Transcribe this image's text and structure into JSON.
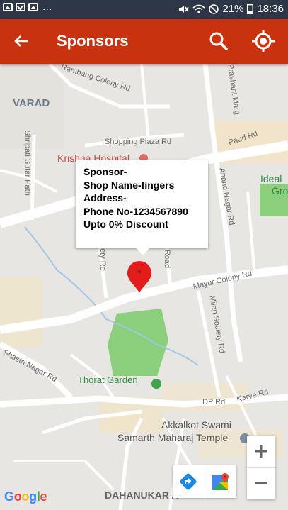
{
  "status_bar": {
    "overflow": "...",
    "battery_pct": "21%",
    "time": "18:36"
  },
  "app_bar": {
    "title": "Sponsors",
    "back_icon": "arrow-left-icon",
    "search_icon": "search-icon",
    "locate_icon": "my-location-icon",
    "color": "#c8320f"
  },
  "map": {
    "labels": {
      "varad": "VARAD",
      "rambaug": "Rambaug Colony Rd",
      "prashant": "Prashant Marg",
      "shopping_plaza": "Shopping Plaza Rd",
      "paud": "Paud Rd",
      "krishna": "Krishna Hospital",
      "shripati": "Shripati Sutar Path",
      "ideal": "Ideal",
      "gro": "Gro",
      "anand": "Anand Nagar Rd",
      "society": "ociety Rd",
      "road": "Road",
      "mayur": "Mayur Colony Rd",
      "milan": "Milan Society Rd",
      "shastri": "Shastri Nagar Rd",
      "thorat": "Thorat Garden",
      "dp": "DP Rd",
      "karve": "Karve Rd",
      "akkalkot_1": "Akkalkot Swami",
      "akkalkot_2": "Samarth Maharaj Temple",
      "dahanukar": "DAHANUKAR A"
    },
    "info_window": {
      "lines": [
        "Sponsor-",
        "Shop Name-fingers",
        "Address-",
        "Phone No-1234567890",
        "Upto 0% Discount"
      ]
    },
    "marker_color": "#e21b1b",
    "zoom_in_label": "+",
    "zoom_out_label": "−",
    "google": "Google"
  }
}
